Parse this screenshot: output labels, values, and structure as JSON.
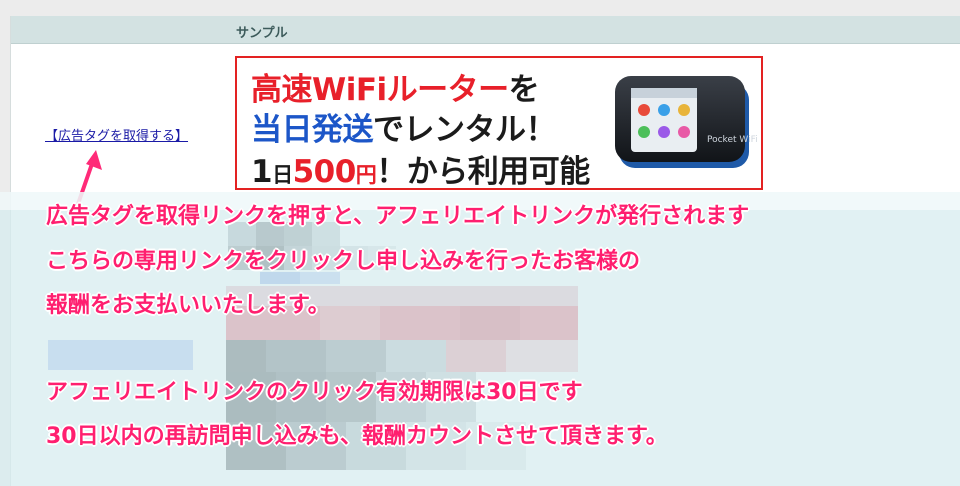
{
  "panel": {
    "title": "サンプル"
  },
  "ad_link": {
    "label": "【広告タグを取得する】"
  },
  "banner": {
    "line1_a": "高速WiFiルーター",
    "line1_b": "を",
    "line2_a": "当日発送",
    "line2_b": "でレンタル！",
    "line3_a": "1",
    "line3_b": "日",
    "line3_c": "500",
    "line3_d": "円",
    "line3_e": "！から利用可能",
    "device_brand": "Pocket WiFi",
    "colors": {
      "border": "#e32222",
      "red": "#e8202a",
      "blue": "#1c56c8"
    }
  },
  "annotation": {
    "lines": [
      "広告タグを取得リンクを押すと、アフェリエイトリンクが発行されます",
      "こちらの専用リンクをクリックし申し込みを行ったお客様の",
      "報酬をお支払いいたします。",
      "アフェリエイトリンクのクリック有効期限は30日です",
      "30日以内の再訪問申し込みも、報酬カウントさせて頂きます。"
    ],
    "color": "#ff1f6f"
  }
}
